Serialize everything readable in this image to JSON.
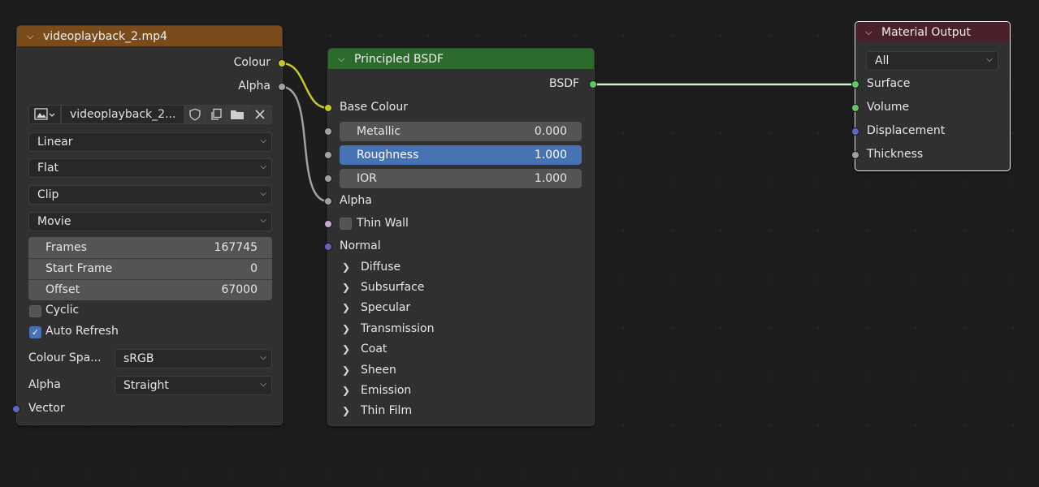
{
  "image_node": {
    "title": "videoplayback_2.mp4",
    "outputs": {
      "colour": "Colour",
      "alpha": "Alpha"
    },
    "image_name": "videoplayback_2...",
    "interpolation": "Linear",
    "projection": "Flat",
    "extension": "Clip",
    "source": "Movie",
    "frames": {
      "label": "Frames",
      "value": "167745"
    },
    "start_frame": {
      "label": "Start Frame",
      "value": "0"
    },
    "offset": {
      "label": "Offset",
      "value": "67000"
    },
    "cyclic": {
      "label": "Cyclic",
      "checked": false
    },
    "auto_refresh": {
      "label": "Auto Refresh",
      "checked": true
    },
    "colour_space": {
      "label": "Colour Spa...",
      "value": "sRGB"
    },
    "alpha_mode": {
      "label": "Alpha",
      "value": "Straight"
    },
    "vector_label": "Vector",
    "header_color": "#7a4c1c"
  },
  "bsdf_node": {
    "title": "Principled BSDF",
    "output": "BSDF",
    "base_colour": "Base Colour",
    "metallic": {
      "label": "Metallic",
      "value": "0.000"
    },
    "roughness": {
      "label": "Roughness",
      "value": "1.000"
    },
    "ior": {
      "label": "IOR",
      "value": "1.000"
    },
    "alpha": "Alpha",
    "thin_wall": "Thin Wall",
    "normal": "Normal",
    "panels": [
      "Diffuse",
      "Subsurface",
      "Specular",
      "Transmission",
      "Coat",
      "Sheen",
      "Emission",
      "Thin Film"
    ],
    "header_color": "#2d6a2d"
  },
  "output_node": {
    "title": "Material Output",
    "target": "All",
    "inputs": [
      "Surface",
      "Volume",
      "Displacement",
      "Thickness"
    ],
    "header_color": "#4a2128"
  },
  "colors": {
    "background": "#1d1d1d",
    "socket_color": "#c7c729",
    "socket_shader": "#63c763",
    "socket_float": "#a1a1a1",
    "socket_vector": "#6363c7",
    "selection_blue": "#4772b3"
  }
}
